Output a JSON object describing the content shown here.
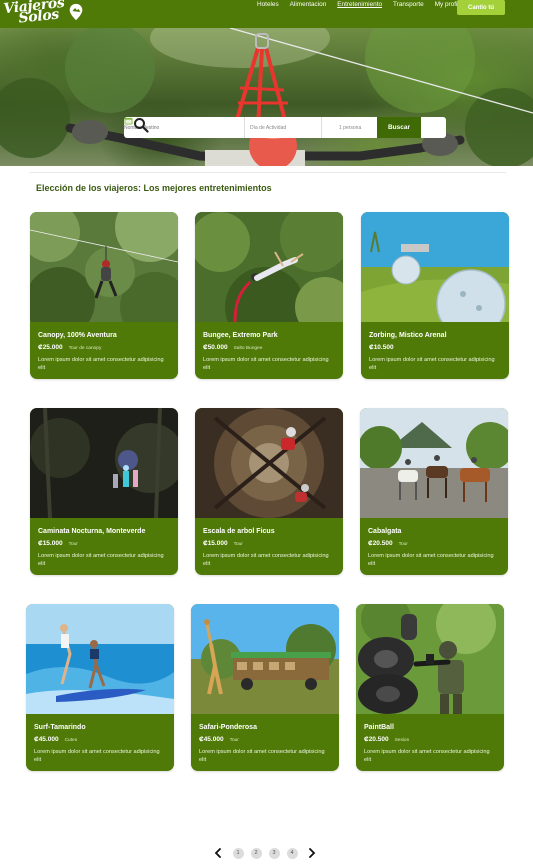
{
  "brand": {
    "name_line1": "Viajeros",
    "name_line2": "Solos"
  },
  "nav": {
    "links": [
      "Hoteles",
      "Alimentacion",
      "Entretenimiento",
      "Transporte",
      "My profile"
    ],
    "active_index": 2,
    "cta_label": "Cantio tú"
  },
  "search": {
    "destination_placeholder": "Nombre destino",
    "date_placeholder": "Día de Actividad",
    "people_placeholder": "1 persona",
    "button_label": "Buscar"
  },
  "section": {
    "title": "Elección de los viajeros: Los mejores entretenimientos"
  },
  "cards": [
    {
      "title": "Canopy, 100% Aventura",
      "price": "₡25.000",
      "tag": "Tour de canopy",
      "desc": "Lorem ipsum dolor sit amet consectetur adipisicing elit",
      "image": "canopy-zipline"
    },
    {
      "title": "Bungee, Extremo Park",
      "price": "₡50.000",
      "tag": "Salto Bungee",
      "desc": "Lorem ipsum dolor sit amet consectetur adipisicing elit",
      "image": "bungee-jump"
    },
    {
      "title": "Zorbing, Mistico Arenal",
      "price": "₡10.500",
      "tag": "",
      "desc": "Lorem ipsum dolor sit amet consectetur adipisicing elit",
      "image": "zorbing-ball"
    },
    {
      "title": "Caminata Nocturna, Monteverde",
      "price": "₡15.000",
      "tag": "Tour",
      "desc": "Lorem ipsum dolor sit amet consectetur adipisicing elit",
      "image": "night-walk"
    },
    {
      "title": "Escala de arbol Ficus",
      "price": "₡15.000",
      "tag": "Tour",
      "desc": "Lorem ipsum dolor sit amet consectetur adipisicing elit",
      "image": "ficus-tree-climb"
    },
    {
      "title": "Cabalgata",
      "price": "₡20.500",
      "tag": "Tour",
      "desc": "Lorem ipsum dolor sit amet consectetur adipisicing elit",
      "image": "horseback-volcano"
    },
    {
      "title": "Surf-Tamarindo",
      "price": "₡45.000",
      "tag": "Cutes",
      "desc": "Lorem ipsum dolor sit amet consectetur adipisicing elit",
      "image": "surf-lesson"
    },
    {
      "title": "Safari-Ponderosa",
      "price": "₡45.000",
      "tag": "Tour",
      "desc": "Lorem ipsum dolor sit amet consectetur adipisicing elit",
      "image": "safari-giraffe"
    },
    {
      "title": "PaintBall",
      "price": "₡20.500",
      "tag": "Sesion",
      "desc": "Lorem ipsum dolor sit amet consectetur adipisicing elit",
      "image": "paintball-player"
    }
  ],
  "pagination": {
    "pages": [
      "1",
      "2",
      "3",
      "4"
    ],
    "prev_icon": "chevron-left-icon",
    "next_icon": "chevron-right-icon"
  },
  "colors": {
    "primary_green": "#4f7a07",
    "accent_green": "#a4d13a",
    "button_dark_green": "#3f6a06"
  }
}
